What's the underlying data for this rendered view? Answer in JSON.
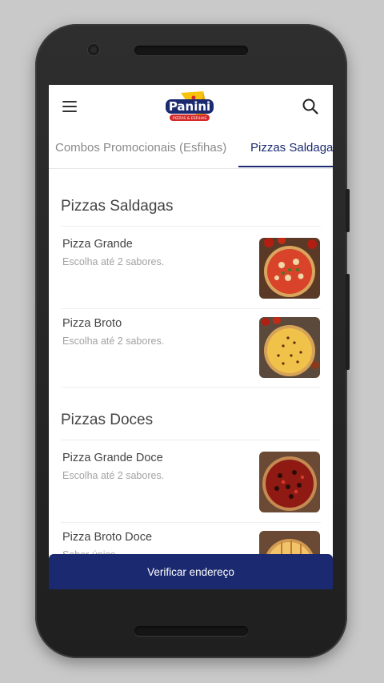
{
  "app": {
    "logo_text": "Panini",
    "logo_subtext": "PIZZAS & ESFIHAS"
  },
  "tabs": [
    {
      "label": "Combos Promocionais (Esfihas)",
      "active": false
    },
    {
      "label": "Pizzas Saldagas",
      "active": true
    }
  ],
  "sections": [
    {
      "title": "Pizzas Saldagas",
      "items": [
        {
          "name": "Pizza Grande",
          "description": "Escolha até 2 sabores."
        },
        {
          "name": "Pizza Broto",
          "description": "Escolha até 2 sabores."
        }
      ]
    },
    {
      "title": "Pizzas Doces",
      "items": [
        {
          "name": "Pizza Grande Doce",
          "description": "Escolha até 2 sabores."
        },
        {
          "name": "Pizza Broto Doce",
          "description": "Sabor único"
        }
      ]
    }
  ],
  "cta": {
    "label": "Verificar endereço"
  },
  "colors": {
    "accent": "#1b2a70",
    "background": "#c9c9c9"
  }
}
